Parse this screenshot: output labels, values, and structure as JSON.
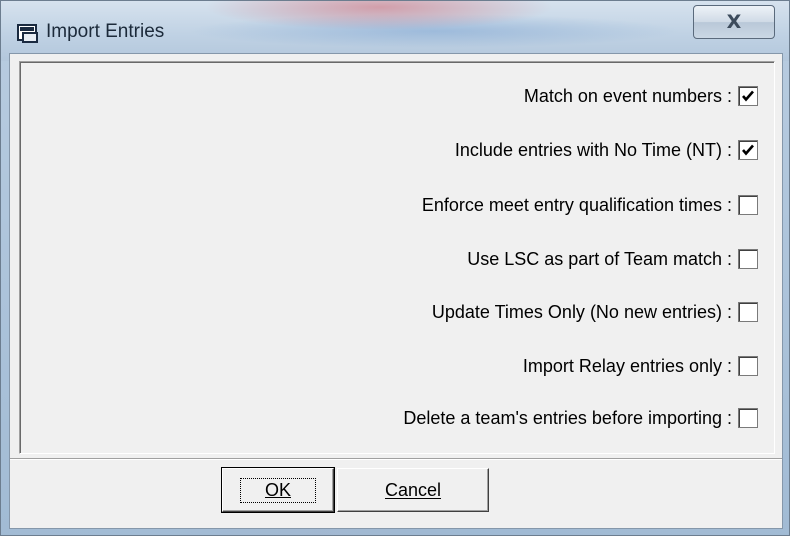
{
  "window": {
    "title": "Import Entries",
    "close_label": "X",
    "app_icon": "import-entries-icon"
  },
  "options": [
    {
      "label": "Match on event numbers :",
      "checked": true
    },
    {
      "label": "Include entries with No Time (NT) :",
      "checked": true
    },
    {
      "label": "Enforce meet entry qualification times :",
      "checked": false
    },
    {
      "label": "Use LSC as part of Team match :",
      "checked": false
    },
    {
      "label": "Update Times Only (No new entries) :",
      "checked": false
    },
    {
      "label": "Import Relay entries only :",
      "checked": false
    },
    {
      "label": "Delete a team's entries before importing :",
      "checked": false
    }
  ],
  "buttons": {
    "ok_label": "OK",
    "cancel_label": "Cancel"
  }
}
